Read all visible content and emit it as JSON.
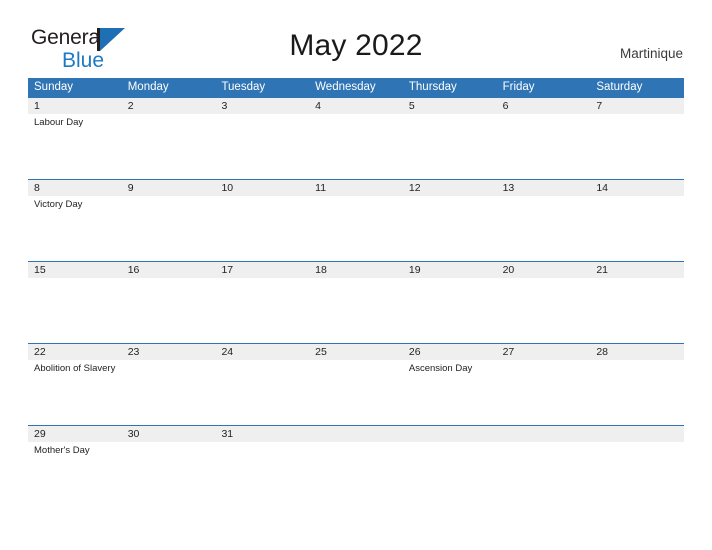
{
  "brand": {
    "name_part1": "General",
    "name_part2": "Blue",
    "flag_icon": "flag-triangle-icon",
    "colors": {
      "dark": "#231f20",
      "blue": "#1f7ac4",
      "flag": "#1f6fb5"
    }
  },
  "header": {
    "title": "May 2022",
    "location": "Martinique"
  },
  "theme": {
    "header_blue": "#2f74b5",
    "row_band_gray": "#efefef",
    "cell_white": "#ffffff",
    "text": "#1f1f1f"
  },
  "calendar": {
    "month": "May",
    "year": "2022",
    "weekday_headers": [
      "Sunday",
      "Monday",
      "Tuesday",
      "Wednesday",
      "Thursday",
      "Friday",
      "Saturday"
    ],
    "weeks": [
      {
        "days": [
          {
            "num": "1",
            "event": "Labour Day"
          },
          {
            "num": "2",
            "event": ""
          },
          {
            "num": "3",
            "event": ""
          },
          {
            "num": "4",
            "event": ""
          },
          {
            "num": "5",
            "event": ""
          },
          {
            "num": "6",
            "event": ""
          },
          {
            "num": "7",
            "event": ""
          }
        ]
      },
      {
        "days": [
          {
            "num": "8",
            "event": "Victory Day"
          },
          {
            "num": "9",
            "event": ""
          },
          {
            "num": "10",
            "event": ""
          },
          {
            "num": "11",
            "event": ""
          },
          {
            "num": "12",
            "event": ""
          },
          {
            "num": "13",
            "event": ""
          },
          {
            "num": "14",
            "event": ""
          }
        ]
      },
      {
        "days": [
          {
            "num": "15",
            "event": ""
          },
          {
            "num": "16",
            "event": ""
          },
          {
            "num": "17",
            "event": ""
          },
          {
            "num": "18",
            "event": ""
          },
          {
            "num": "19",
            "event": ""
          },
          {
            "num": "20",
            "event": ""
          },
          {
            "num": "21",
            "event": ""
          }
        ]
      },
      {
        "days": [
          {
            "num": "22",
            "event": "Abolition of Slavery"
          },
          {
            "num": "23",
            "event": ""
          },
          {
            "num": "24",
            "event": ""
          },
          {
            "num": "25",
            "event": ""
          },
          {
            "num": "26",
            "event": "Ascension Day"
          },
          {
            "num": "27",
            "event": ""
          },
          {
            "num": "28",
            "event": ""
          }
        ]
      },
      {
        "days": [
          {
            "num": "29",
            "event": "Mother's Day"
          },
          {
            "num": "30",
            "event": ""
          },
          {
            "num": "31",
            "event": ""
          },
          {
            "num": "",
            "event": ""
          },
          {
            "num": "",
            "event": ""
          },
          {
            "num": "",
            "event": ""
          },
          {
            "num": "",
            "event": ""
          }
        ]
      }
    ]
  }
}
